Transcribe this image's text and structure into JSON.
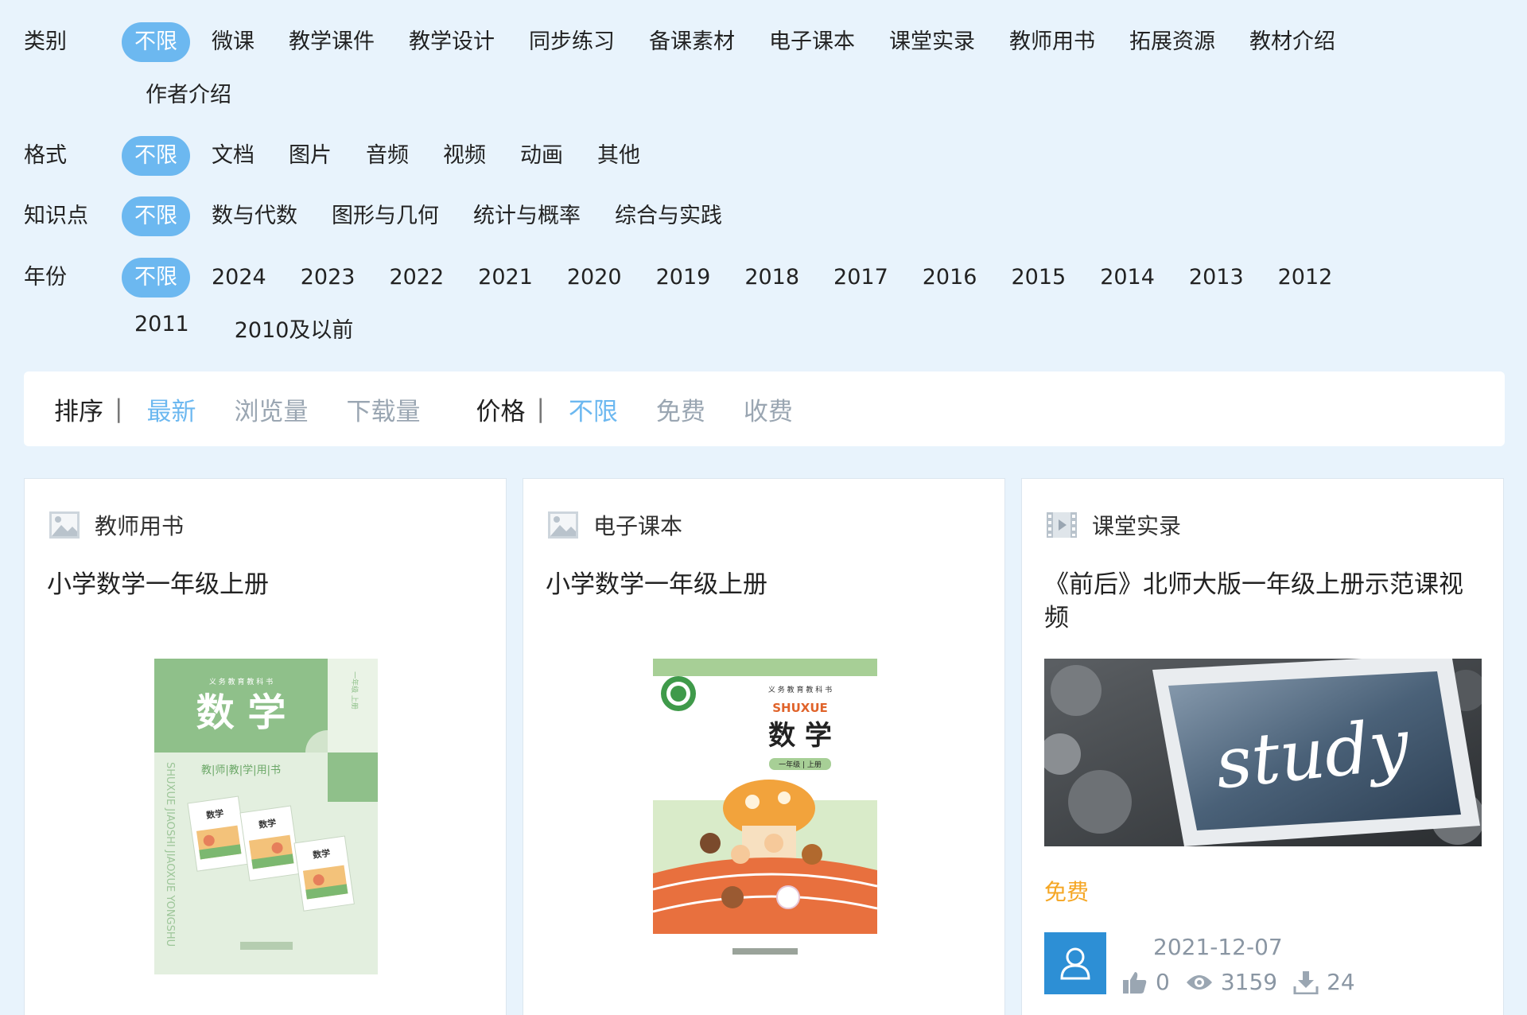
{
  "filters": {
    "category": {
      "label": "类别",
      "options": [
        "不限",
        "微课",
        "教学课件",
        "教学设计",
        "同步练习",
        "备课素材",
        "电子课本",
        "课堂实录",
        "教师用书",
        "拓展资源",
        "教材介绍",
        "作者介绍"
      ]
    },
    "format": {
      "label": "格式",
      "options": [
        "不限",
        "文档",
        "图片",
        "音频",
        "视频",
        "动画",
        "其他"
      ]
    },
    "knowledge": {
      "label": "知识点",
      "options": [
        "不限",
        "数与代数",
        "图形与几何",
        "统计与概率",
        "综合与实践"
      ]
    },
    "year": {
      "label": "年份",
      "options": [
        "不限",
        "2024",
        "2023",
        "2022",
        "2021",
        "2020",
        "2019",
        "2018",
        "2017",
        "2016",
        "2015",
        "2014",
        "2013",
        "2012",
        "2011",
        "2010及以前"
      ]
    }
  },
  "sort_bar": {
    "sort_label": "排序",
    "sort_options": [
      "最新",
      "浏览量",
      "下载量"
    ],
    "price_label": "价格",
    "price_options": [
      "不限",
      "免费",
      "收费"
    ],
    "separator": "|"
  },
  "cards": [
    {
      "category": "教师用书",
      "category_icon": "image-icon",
      "title": "小学数学一年级上册",
      "cover": {
        "series": "义 务 教 育 教 科 书",
        "subject": "数 学",
        "side_text": "一年级 上册",
        "subtitle": "教|师|教|学|用|书",
        "vertical_text": "SHUXUE JIAOSHI JIAOXUE YONGSHU",
        "mini_book_title": "数学"
      }
    },
    {
      "category": "电子课本",
      "category_icon": "image-icon",
      "title": "小学数学一年级上册",
      "cover": {
        "series": "义 务 教 育 教 科 书",
        "pinyin": "SHUXUE",
        "subject": "数 学",
        "grade_tag": "一年级 | 上册"
      }
    },
    {
      "category": "课堂实录",
      "category_icon": "video-icon",
      "title": "《前后》北师大版一年级上册示范课视频",
      "cover": {
        "board_text": "study"
      },
      "price": "免费",
      "date": "2021-12-07",
      "likes": "0",
      "views": "3159",
      "downloads": "24"
    }
  ],
  "colors": {
    "background": "#e8f3fc",
    "accent": "#6cb8f0",
    "price": "#f5a623",
    "avatar": "#2d8fd5"
  }
}
